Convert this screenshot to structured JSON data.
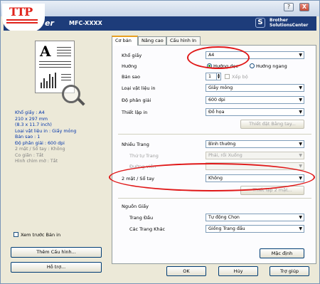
{
  "logo": {
    "text": "TTP"
  },
  "banner": {
    "brand_fragment": "er",
    "model": "MFC-XXXX",
    "solutions_line1": "Brother",
    "solutions_line2": "SolutionsCenter"
  },
  "window_controls": {
    "help": "?",
    "close": "X"
  },
  "left": {
    "info": {
      "paper_size": "Khổ giấy : A4",
      "dims_mm": "210 x 297 mm",
      "dims_in": "(8.3 x 11.7 inch)",
      "media_type": "Loại vật liệu in : Giấy mỏng",
      "copies": "Bản sao : 1",
      "resolution": "Độ phân giải : 600 dpi",
      "duplex": "2 mặt / Sổ tay : Không",
      "scaling": "Co giãn : Tắt",
      "watermark": "Hình chìm mờ : Tắt"
    },
    "preview_checkbox": "Xem trước Bản in",
    "add_profile_button": "Thêm Cấu hình...",
    "support_button": "Hỗ trợ..."
  },
  "tabs": [
    "Cơ bản",
    "Nâng cao",
    "Cấu hình In"
  ],
  "basic": {
    "paper_size_label": "Khổ giấy",
    "paper_size_value": "A4",
    "orientation_label": "Hướng",
    "portrait": "Hướng dọc",
    "landscape": "Hướng ngang",
    "copies_label": "Bản sao",
    "copies_value": "1",
    "collate": "Xếp bộ",
    "media_label": "Loại vật liệu in",
    "media_value": "Giấy mỏng",
    "resolution_label": "Độ phân giải",
    "resolution_value": "600 dpi",
    "settings_label": "Thiết lập in",
    "settings_value": "Đồ họa",
    "manual_settings_button": "Thiết đặt Bằng tay...",
    "multipage_label": "Nhiều Trang",
    "multipage_value": "Bình thường",
    "page_order_label": "Thứ tự Trang",
    "page_order_value": "Phải, rồi Xuống",
    "border_line_label": "Đường viền",
    "duplex_label": "2 mặt / Sổ tay",
    "duplex_value": "Không",
    "duplex_settings_button": "Thiết lập 2 mặt...",
    "paper_source_label": "Nguồn Giấy",
    "first_page_label": "Trang Đầu",
    "first_page_value": "Tự động Chọn",
    "other_pages_label": "Các Trang Khác",
    "other_pages_value": "Giống Trang đầu",
    "default_button": "Mặc định"
  },
  "footer": {
    "ok": "OK",
    "cancel": "Hủy",
    "help": "Trợ giúp"
  },
  "colors": {
    "banner": "#1d3c7a",
    "logo_red": "#e0231b",
    "annotation": "#e01818",
    "info_text": "#0033aa"
  }
}
